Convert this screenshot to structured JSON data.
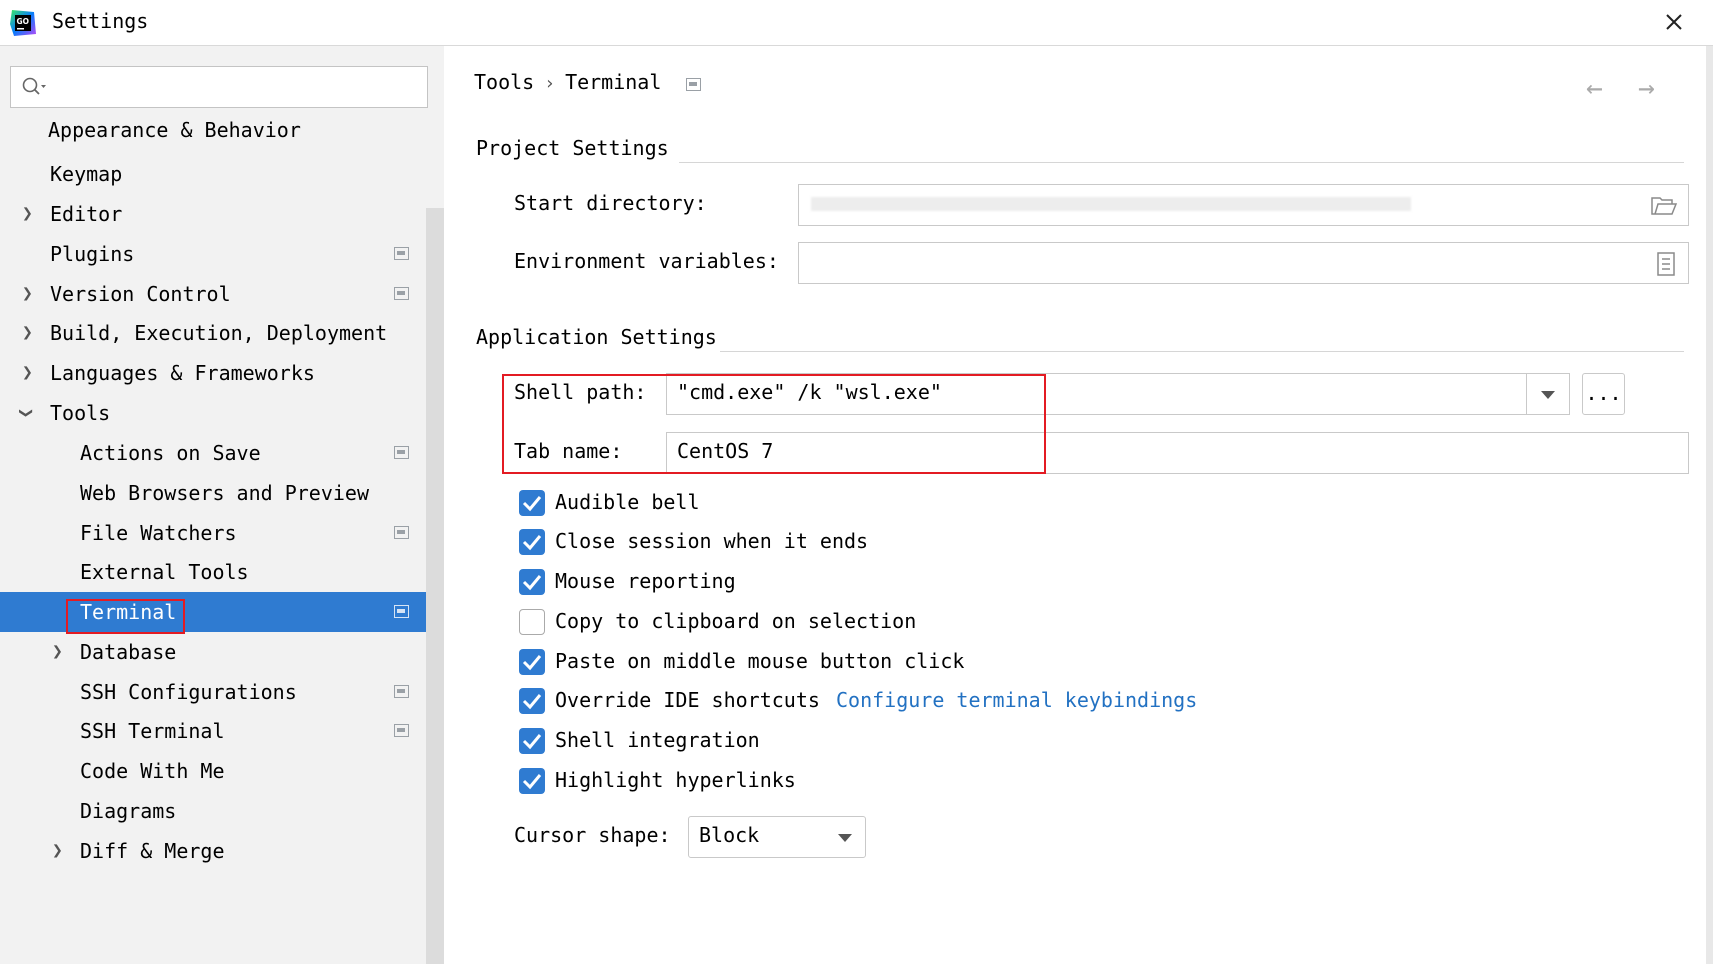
{
  "window": {
    "title": "Settings",
    "logo_text": "GO"
  },
  "search": {
    "placeholder": ""
  },
  "sidebar": {
    "items": [
      {
        "label": "Appearance & Behavior"
      },
      {
        "label": "Keymap"
      },
      {
        "label": "Editor"
      },
      {
        "label": "Plugins"
      },
      {
        "label": "Version Control"
      },
      {
        "label": "Build, Execution, Deployment"
      },
      {
        "label": "Languages & Frameworks"
      },
      {
        "label": "Tools"
      },
      {
        "label": "Actions on Save"
      },
      {
        "label": "Web Browsers and Preview"
      },
      {
        "label": "File Watchers"
      },
      {
        "label": "External Tools"
      },
      {
        "label": "Terminal"
      },
      {
        "label": "Database"
      },
      {
        "label": "SSH Configurations"
      },
      {
        "label": "SSH Terminal"
      },
      {
        "label": "Code With Me"
      },
      {
        "label": "Diagrams"
      },
      {
        "label": "Diff & Merge"
      }
    ],
    "selected": "Terminal"
  },
  "breadcrumb": {
    "parent": "Tools",
    "separator": "›",
    "current": "Terminal"
  },
  "project_settings": {
    "heading": "Project Settings",
    "start_directory_label": "Start directory:",
    "start_directory_value": "",
    "env_vars_label": "Environment variables:",
    "env_vars_value": ""
  },
  "app_settings": {
    "heading": "Application Settings",
    "shell_path_label": "Shell path:",
    "shell_path_value": "\"cmd.exe\" /k \"wsl.exe\"",
    "browse_label": "...",
    "tab_name_label": "Tab name:",
    "tab_name_value": "CentOS 7",
    "checkboxes": [
      {
        "label": "Audible bell",
        "checked": true
      },
      {
        "label": "Close session when it ends",
        "checked": true
      },
      {
        "label": "Mouse reporting",
        "checked": true
      },
      {
        "label": "Copy to clipboard on selection",
        "checked": false
      },
      {
        "label": "Paste on middle mouse button click",
        "checked": true
      },
      {
        "label": "Override IDE shortcuts",
        "checked": true
      },
      {
        "label": "Shell integration",
        "checked": true
      },
      {
        "label": "Highlight hyperlinks",
        "checked": true
      }
    ],
    "keybindings_link": "Configure terminal keybindings",
    "cursor_shape_label": "Cursor shape:",
    "cursor_shape_value": "Block"
  },
  "colors": {
    "accent": "#2f7bd1",
    "highlight_box": "#e31b23",
    "link": "#2271c2"
  }
}
